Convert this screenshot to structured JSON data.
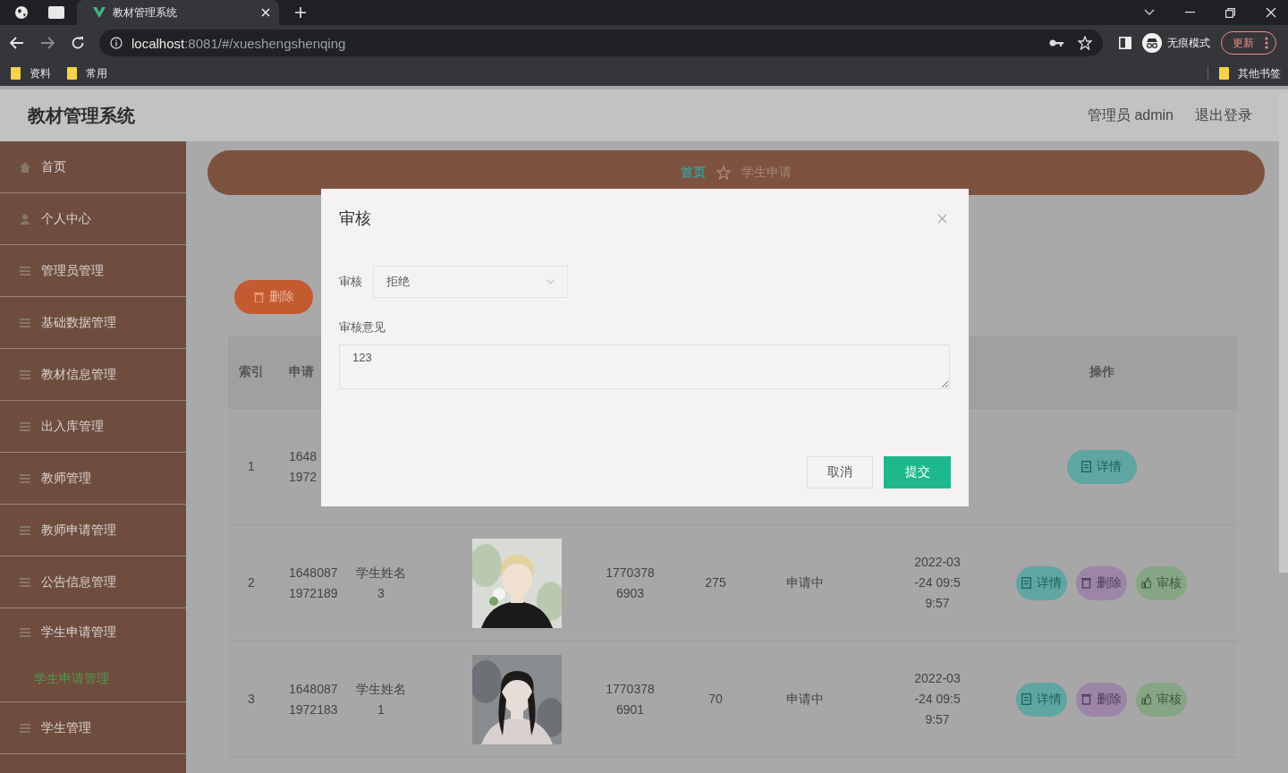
{
  "browser": {
    "tab_title": "教材管理系统",
    "url_host": "localhost",
    "url_rest": ":8081/#/xueshengshenqing",
    "incognito_label": "无痕模式",
    "update_button": "更新",
    "bookmarks": [
      "资料",
      "常用"
    ],
    "other_bookmarks": "其他书签"
  },
  "header": {
    "title": "教材管理系统",
    "user": "管理员 admin",
    "logout": "退出登录"
  },
  "sidebar": {
    "items": [
      {
        "label": "首页",
        "kind": "home",
        "expanded": false
      },
      {
        "label": "个人中心",
        "kind": "user",
        "expanded": false
      },
      {
        "label": "管理员管理",
        "kind": "list",
        "expanded": false
      },
      {
        "label": "基础数据管理",
        "kind": "list",
        "expanded": false
      },
      {
        "label": "教材信息管理",
        "kind": "list",
        "expanded": false
      },
      {
        "label": "出入库管理",
        "kind": "list",
        "expanded": false
      },
      {
        "label": "教师管理",
        "kind": "list",
        "expanded": false
      },
      {
        "label": "教师申请管理",
        "kind": "list",
        "expanded": false
      },
      {
        "label": "公告信息管理",
        "kind": "list",
        "expanded": false
      },
      {
        "label": "学生申请管理",
        "kind": "list",
        "expanded": true,
        "children": [
          {
            "label": "学生申请管理",
            "selected": true
          }
        ]
      },
      {
        "label": "学生管理",
        "kind": "list",
        "expanded": false
      }
    ]
  },
  "breadcrumb": {
    "home": "首页",
    "current": "学生申请"
  },
  "toolbar": {
    "delete_button": "删除"
  },
  "table": {
    "columns": {
      "index": "索引",
      "column_2": "申请",
      "actions": "操作"
    },
    "rows": [
      {
        "index": "1",
        "apply_no": "1648\n1972",
        "actions": [
          {
            "kind": "detail",
            "label": "详情"
          }
        ]
      },
      {
        "index": "2",
        "apply_no": "16480871972189",
        "name": "学生姓名3",
        "phone": "17703786903",
        "count": "275",
        "status": "申请中",
        "time": "2022-03-24 09:59:57",
        "actions": [
          {
            "kind": "detail",
            "label": "详情"
          },
          {
            "kind": "delete",
            "label": "删除"
          },
          {
            "kind": "review",
            "label": "审核"
          }
        ]
      },
      {
        "index": "3",
        "apply_no": "16480871972183",
        "name": "学生姓名1",
        "phone": "17703786901",
        "count": "70",
        "status": "申请中",
        "time": "2022-03-24 09:59:57",
        "actions": [
          {
            "kind": "detail",
            "label": "详情"
          },
          {
            "kind": "delete",
            "label": "删除"
          },
          {
            "kind": "review",
            "label": "审核"
          }
        ]
      }
    ]
  },
  "dialog": {
    "title": "审核",
    "fields": [
      {
        "kind": "select",
        "label": "审核",
        "value": "拒绝"
      },
      {
        "kind": "textarea",
        "label": "审核意见",
        "value": "123"
      }
    ],
    "buttons": [
      {
        "kind": "cancel",
        "label": "取消"
      },
      {
        "kind": "primary",
        "label": "提交"
      }
    ]
  }
}
